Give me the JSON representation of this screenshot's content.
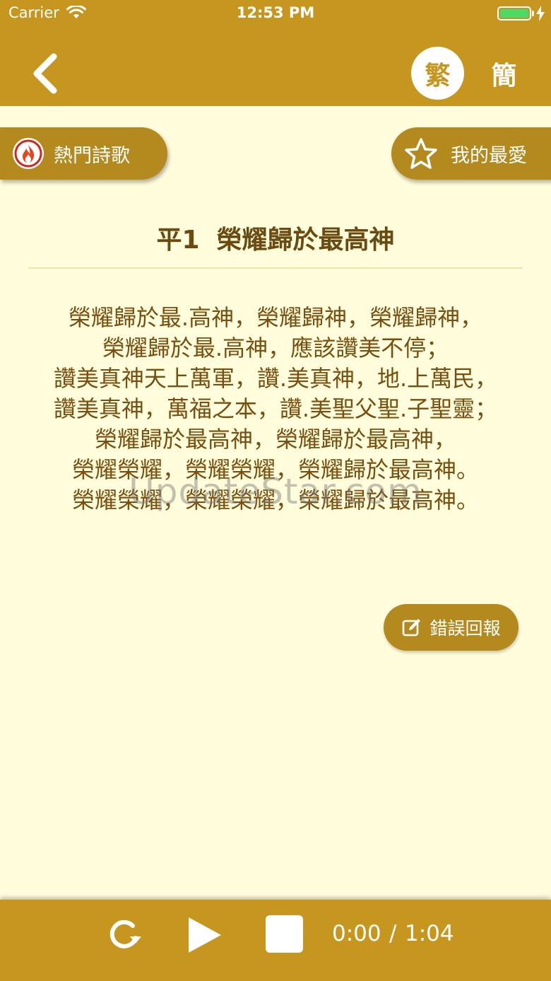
{
  "status_bar": {
    "carrier": "Carrier",
    "time": "12:53 PM"
  },
  "header": {
    "back_icon": "chevron-left-icon",
    "lang_traditional": "繁",
    "lang_simplified": "簡",
    "selected_lang": "traditional"
  },
  "actions": {
    "hot_songs_label": "熱門詩歌",
    "hot_songs_icon": "fire-icon",
    "favorites_label": "我的最愛",
    "favorites_icon": "star-icon"
  },
  "song": {
    "number": "平1",
    "title": "榮耀歸於最高神",
    "lyrics": [
      "榮耀歸於最.高神，榮耀歸神，榮耀歸神，",
      "榮耀歸於最.高神，應該讚美不停；",
      "讚美真神天上萬軍，讚.美真神，地.上萬民，",
      "讚美真神，萬福之本，讚.美聖父聖.子聖靈；",
      "榮耀歸於最高神，榮耀歸於最高神，",
      "榮耀榮耀，榮耀榮耀，榮耀歸於最高神。",
      "榮耀榮耀，榮耀榮耀，榮耀歸於最高神。"
    ]
  },
  "watermark": "UpdateStar.com",
  "report": {
    "label": "錯誤回報",
    "icon": "edit-icon"
  },
  "player": {
    "repeat_icon": "repeat-icon",
    "play_icon": "play-icon",
    "stop_icon": "stop-icon",
    "current_time": "0:00",
    "separator": "/",
    "total_time": "1:04"
  },
  "colors": {
    "bar": "#C6961E",
    "button": "#B48A1E",
    "background": "#FFFDDB",
    "text": "#6B4A12"
  }
}
